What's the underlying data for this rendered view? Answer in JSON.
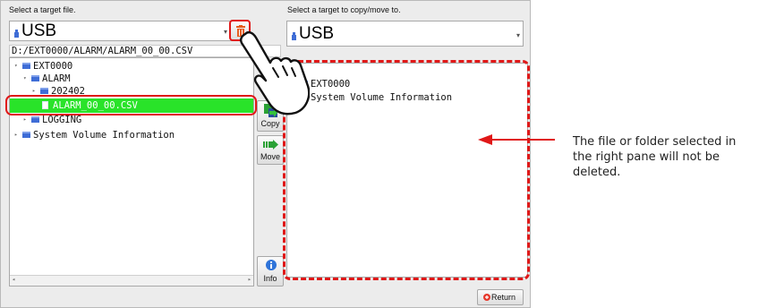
{
  "left": {
    "label": "Select a target file.",
    "drive": "USB",
    "path": "D:/EXT0000/ALARM/ALARM_00_00.CSV",
    "tree": [
      "EXT0000",
      "ALARM",
      "202402",
      "ALARM_00_00.CSV",
      "LOGGING",
      "System Volume Information"
    ]
  },
  "right": {
    "label": "Select a target to copy/move to.",
    "drive": "USB",
    "tree": [
      "EXT0000",
      "System Volume Information"
    ]
  },
  "buttons": {
    "copy": "Copy",
    "move": "Move",
    "info": "Info",
    "ret": "Return"
  },
  "annotation": {
    "line1": "The file or folder selected in",
    "line2": "the right pane will not be",
    "line3": "deleted."
  },
  "colors": {
    "highlight": "#29e329",
    "annotation_red": "#e01818",
    "folder_blue": "#3f6dd6"
  },
  "icons": [
    "usb-icon",
    "trash-icon",
    "copy-icon",
    "move-icon",
    "info-icon",
    "return-icon",
    "hand-pointer-icon",
    "folder-icon",
    "file-icon"
  ]
}
